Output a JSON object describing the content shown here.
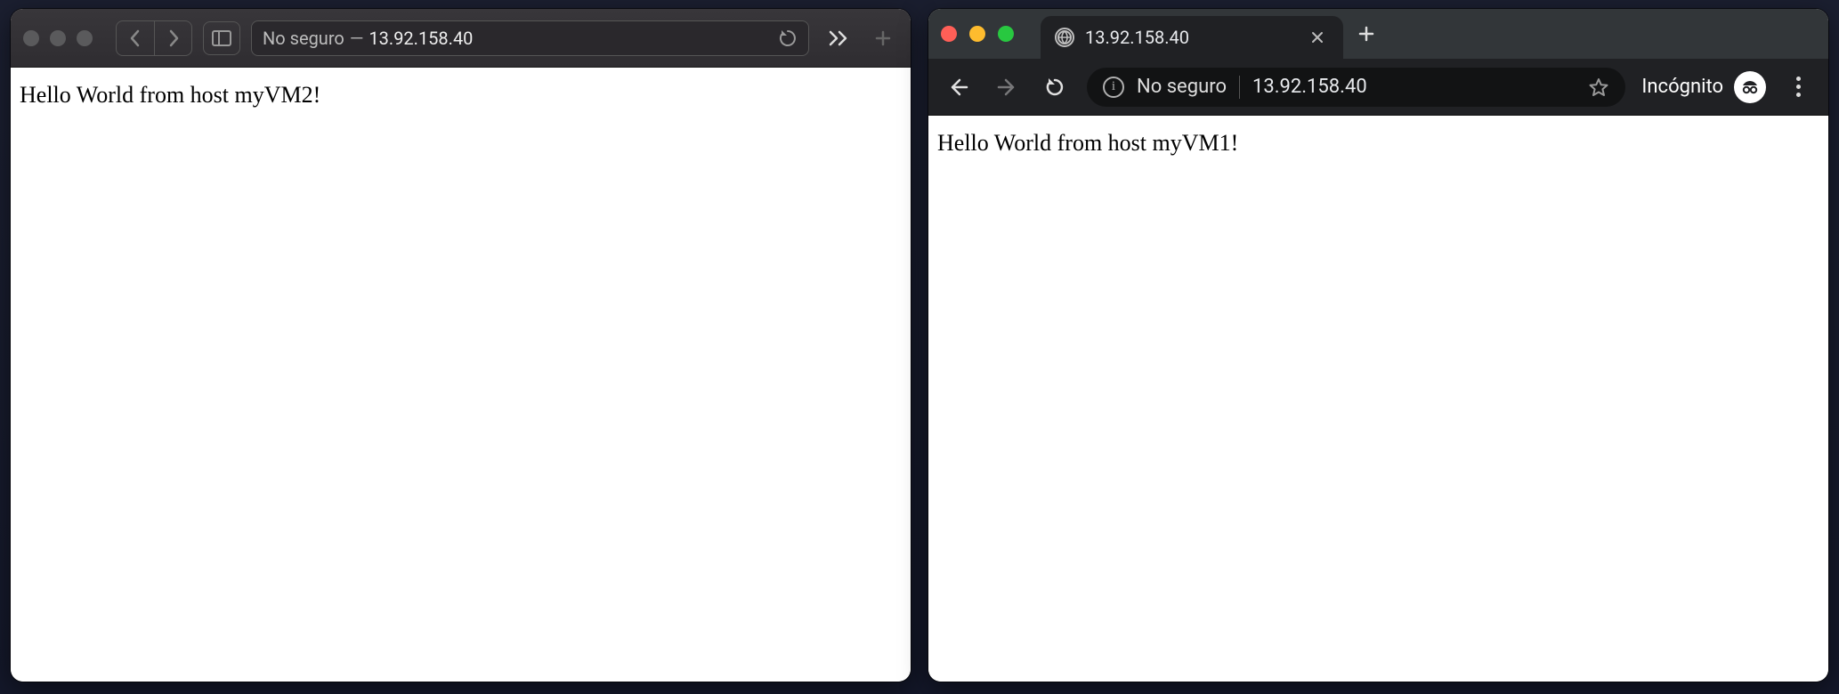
{
  "safari": {
    "security_label": "No seguro",
    "separator": " — ",
    "host": "13.92.158.40",
    "page_text": "Hello World from host myVM2!"
  },
  "chrome": {
    "tab_title": "13.92.158.40",
    "security_label": "No seguro",
    "host": "13.92.158.40",
    "incognito_label": "Incógnito",
    "page_text": "Hello World from host myVM1!"
  }
}
